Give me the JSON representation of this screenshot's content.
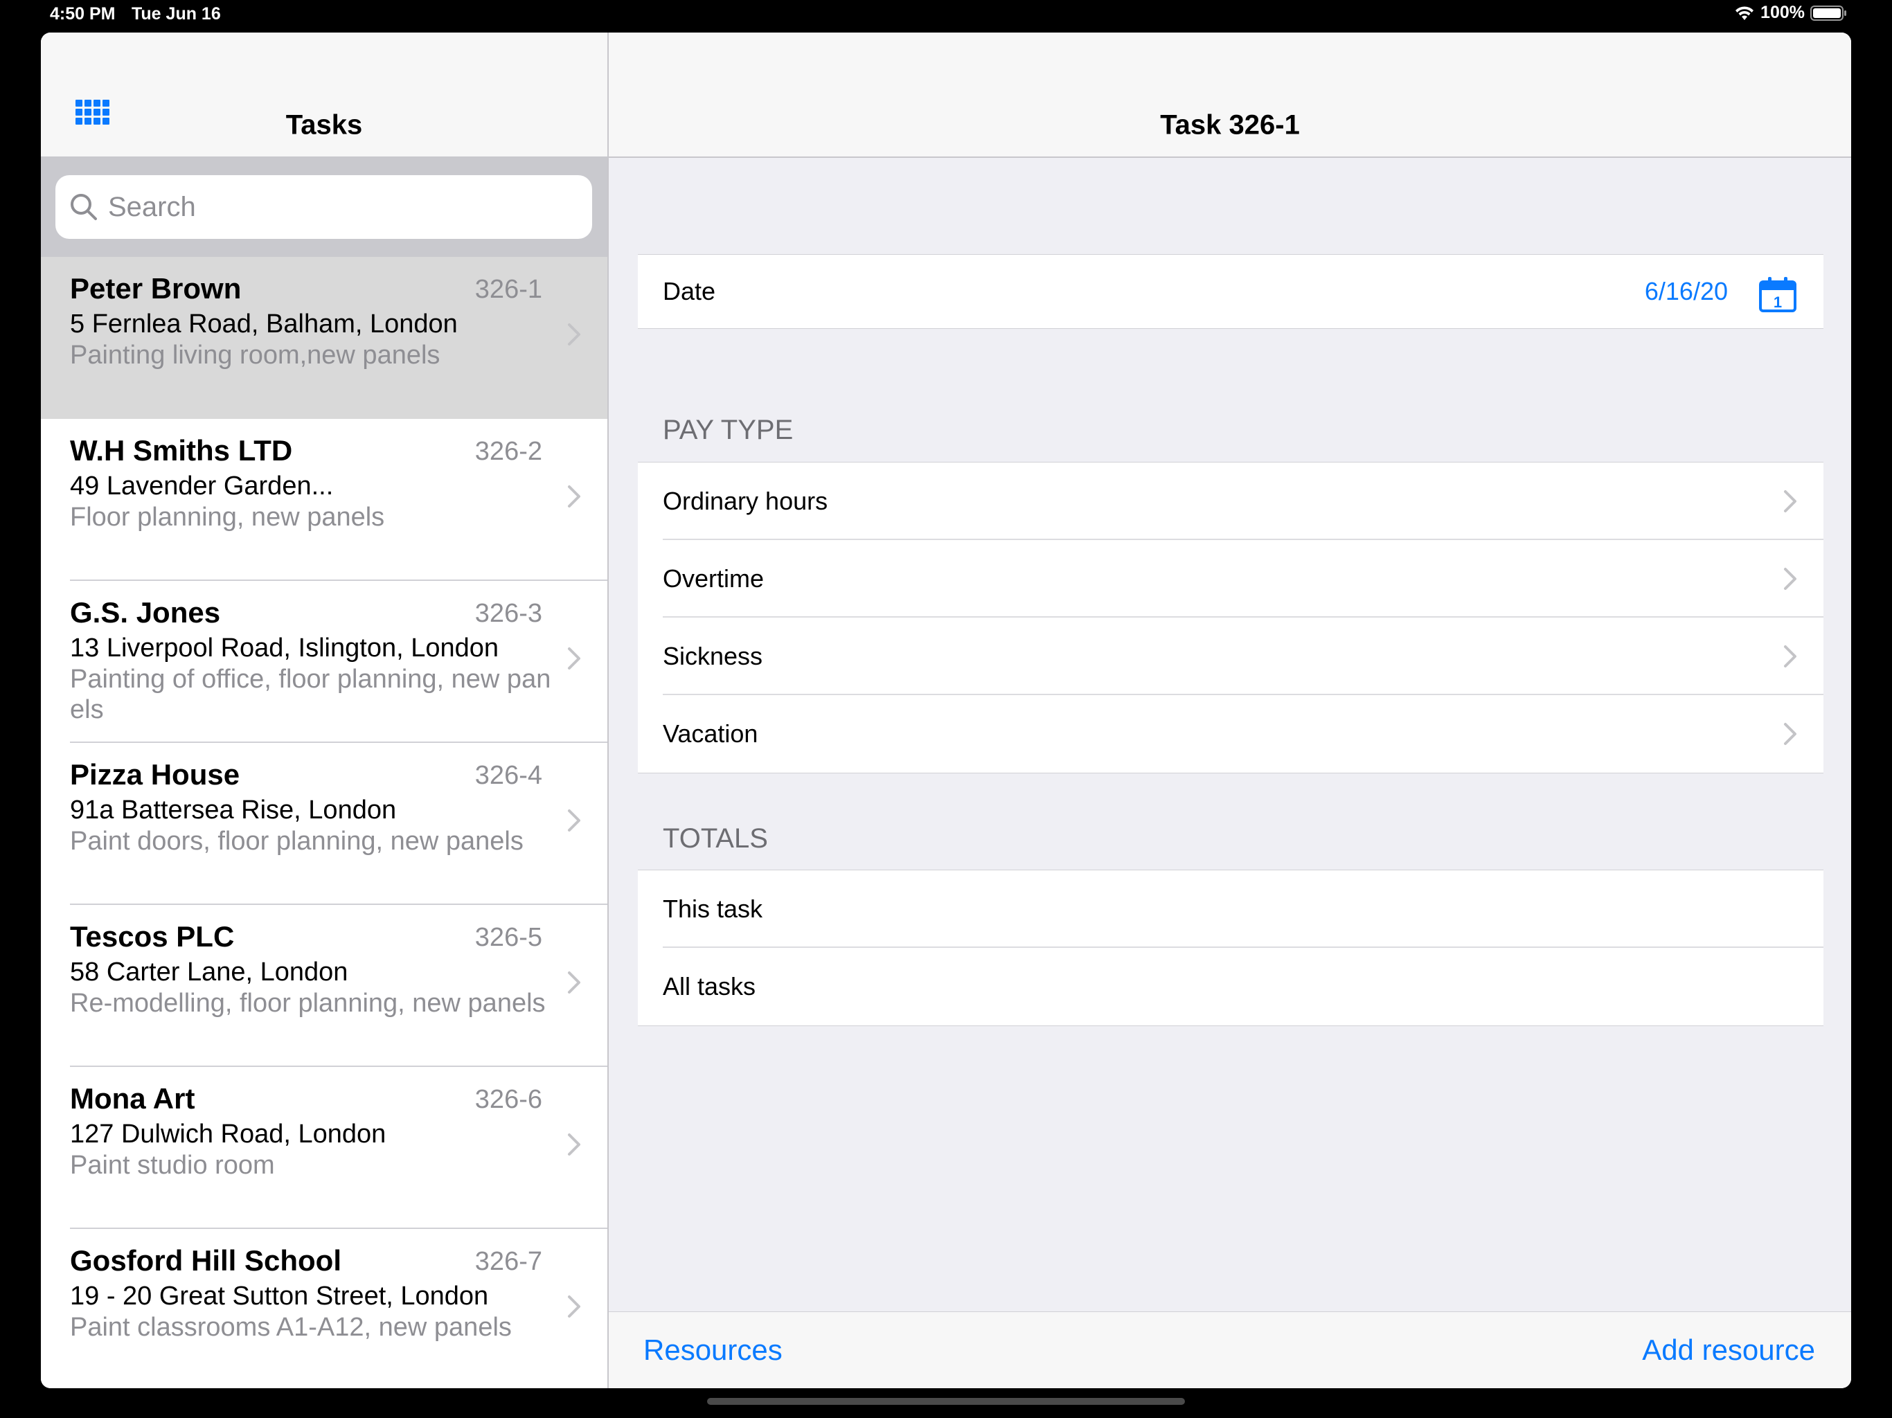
{
  "status_bar": {
    "time": "4:50 PM",
    "date": "Tue Jun 16",
    "battery": "100%"
  },
  "sidebar": {
    "title": "Tasks",
    "grid_icon": "grid-icon",
    "search_placeholder": "Search",
    "tasks": [
      {
        "name": "Peter Brown",
        "id": "326-1",
        "address": "5 Fernlea Road, Balham, London",
        "description": "Painting living room,new panels",
        "selected": true
      },
      {
        "name": "W.H Smiths LTD",
        "id": "326-2",
        "address": "49 Lavender Garden...",
        "description": "Floor planning, new panels",
        "selected": false
      },
      {
        "name": "G.S. Jones",
        "id": "326-3",
        "address": "13 Liverpool Road, Islington, London",
        "description": "Painting of office, floor planning, new panels",
        "selected": false
      },
      {
        "name": "Pizza House",
        "id": "326-4",
        "address": "91a Battersea Rise, London",
        "description": "Paint doors, floor planning, new panels",
        "selected": false
      },
      {
        "name": "Tescos PLC",
        "id": "326-5",
        "address": "58 Carter Lane, London",
        "description": "Re-modelling, floor planning, new panels",
        "selected": false
      },
      {
        "name": "Mona Art",
        "id": "326-6",
        "address": "127 Dulwich Road, London",
        "description": "Paint studio room",
        "selected": false
      },
      {
        "name": "Gosford Hill School",
        "id": "326-7",
        "address": "19 - 20 Great Sutton Street, London",
        "description": "Paint classrooms A1-A12, new panels",
        "selected": false
      }
    ]
  },
  "detail": {
    "title": "Task 326-1",
    "date_label": "Date",
    "date_value": "6/16/20",
    "calendar_day": "1",
    "pay_type_header": "PAY TYPE",
    "pay_types": [
      "Ordinary hours",
      "Overtime",
      "Sickness",
      "Vacation"
    ],
    "totals_header": "TOTALS",
    "totals": [
      "This task",
      "All tasks"
    ],
    "toolbar": {
      "left": "Resources",
      "right": "Add resource"
    }
  },
  "colors": {
    "accent": "#0a7aff",
    "selected_row": "#d9d9d9",
    "secondary_text": "#8e8e93",
    "grouped_background": "#efeff4"
  }
}
